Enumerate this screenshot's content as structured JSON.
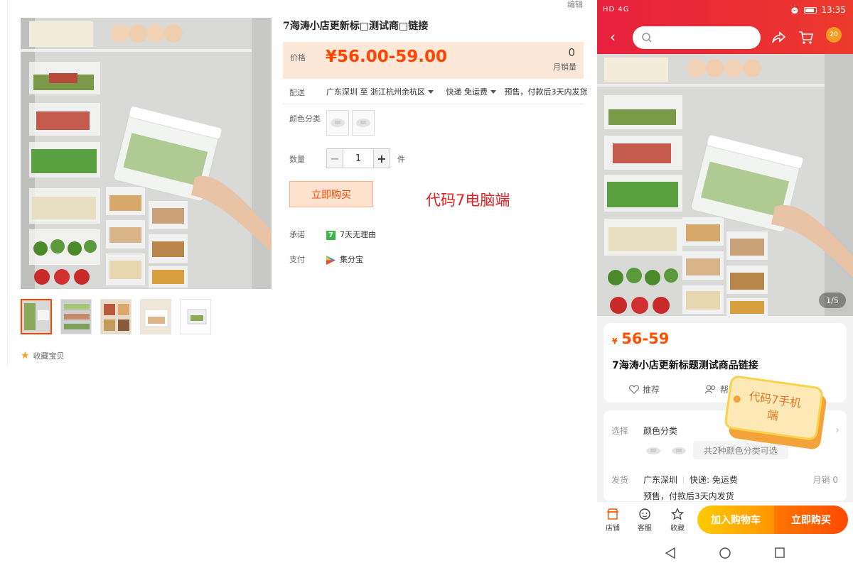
{
  "desktop": {
    "edit_link": "编辑",
    "title": "7海涛小店更新标□测试商□链接",
    "price_label": "价格",
    "price": "¥56.00-59.00",
    "monthly_sales": "0",
    "monthly_sales_label": "月销量",
    "shipping_label": "配送",
    "ship_from": "广东深圳 至",
    "ship_to": "浙江杭州余杭区",
    "delivery": "快递 免运费",
    "presale": "预售，付款后3天内发货",
    "color_label": "颜色分类",
    "quantity_label": "数量",
    "quantity_value": "1",
    "quantity_unit": "件",
    "qty_minus": "−",
    "qty_plus": "+",
    "buy_now": "立即购买",
    "watermark": "代码7电脑端",
    "promise_label": "承诺",
    "promise_icon_text": "7",
    "promise_text": "7天无理由",
    "payment_label": "支付",
    "payment_text": "集分宝",
    "favorite": "收藏宝贝"
  },
  "mobile": {
    "status_time": "13:35",
    "status_left": "HD 4G",
    "cart_badge": "20",
    "image_counter": "1/5",
    "price_currency": "¥",
    "price": "56-59",
    "title": "7海涛小店更新标题测试商品链接",
    "recommend": "推荐",
    "help": "帮我",
    "select_label": "选择",
    "select_value": "颜色分类",
    "color_options_pill": "共2种颜色分类可选",
    "ship_label": "发货",
    "ship_from": "广东深圳",
    "delivery": "快递: 免运费",
    "monthly_sales": "月销 0",
    "presale": "预售，付款后3天内发货",
    "tag_line1": "代码7手机",
    "tag_line2": "端",
    "nav_shop": "店铺",
    "nav_service": "客服",
    "nav_favorite": "收藏",
    "add_to_cart": "加入购物车",
    "buy_now": "立即购买"
  },
  "colors": {
    "accent": "#ff4400",
    "price_bg": "#fde8d8",
    "mobile_header": "#e8203e",
    "cart_button": "#ffa500",
    "buy_button": "#ff5000"
  },
  "icons": [
    "star-icon",
    "seven-day-icon",
    "payment-icon",
    "back-icon",
    "search-icon",
    "share-icon",
    "cart-icon",
    "heart-icon",
    "users-icon",
    "shop-icon",
    "service-icon",
    "favorite-icon",
    "chevron-right-icon"
  ]
}
